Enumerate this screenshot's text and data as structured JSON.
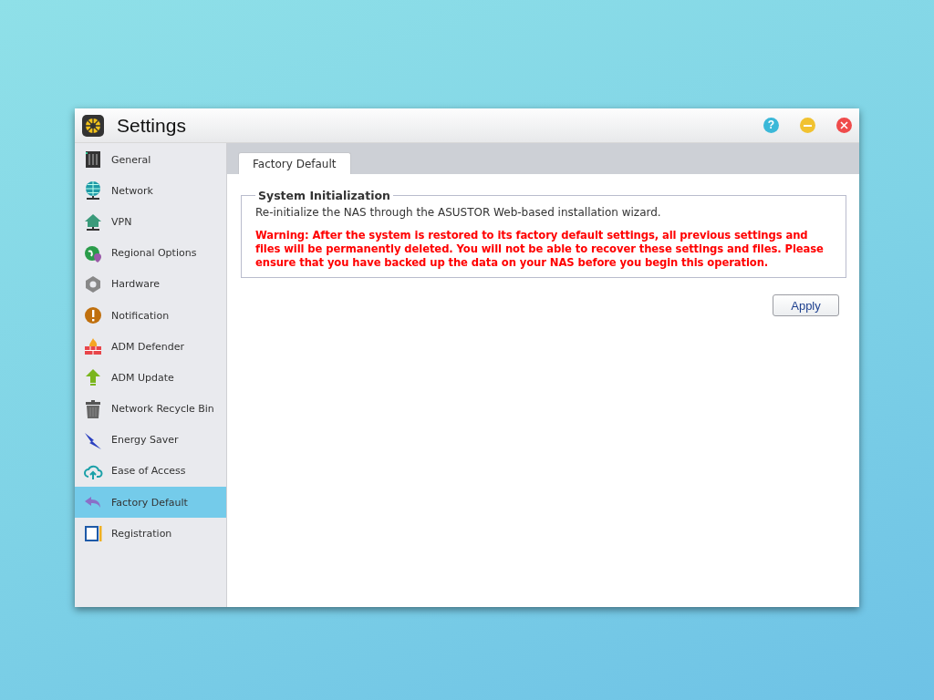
{
  "window": {
    "title": "Settings"
  },
  "window_controls": [
    {
      "kind": "help",
      "label": "?"
    },
    {
      "kind": "minimize"
    },
    {
      "kind": "close"
    }
  ],
  "sidebar": {
    "items": [
      {
        "label": "General",
        "selected": false
      },
      {
        "label": "Network",
        "selected": false
      },
      {
        "label": "VPN",
        "selected": false
      },
      {
        "label": "Regional Options",
        "selected": false
      },
      {
        "label": "Hardware",
        "selected": false
      },
      {
        "label": "Notification",
        "selected": false
      },
      {
        "label": "ADM Defender",
        "selected": false
      },
      {
        "label": "ADM Update",
        "selected": false
      },
      {
        "label": "Network Recycle Bin",
        "selected": false
      },
      {
        "label": "Energy Saver",
        "selected": false
      },
      {
        "label": "Ease of Access",
        "selected": false
      },
      {
        "label": "Factory Default",
        "selected": true
      },
      {
        "label": "Registration",
        "selected": false
      }
    ]
  },
  "tabs": [
    {
      "label": "Factory Default",
      "selected": true
    }
  ],
  "section": {
    "title": "System Initialization",
    "description": "Re-initialize the NAS through the ASUSTOR Web-based installation wizard.",
    "warning": "Warning: After the system is restored to its factory default settings, all previous settings and files will be permanently deleted. You will not be able to recover these settings and files. Please ensure that you have backed up the data on your NAS before you begin this operation."
  },
  "buttons": [
    {
      "label": "Apply"
    }
  ]
}
